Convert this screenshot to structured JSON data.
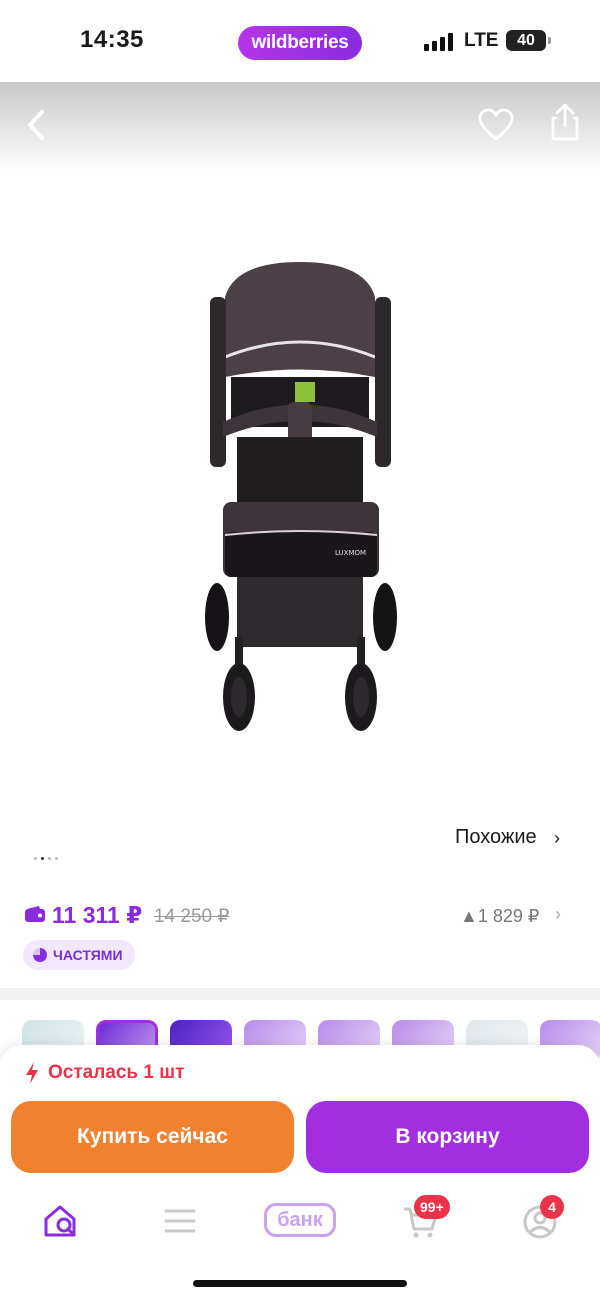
{
  "status_bar": {
    "time": "14:35",
    "brand": "wildberries",
    "network": "LTE",
    "battery": "40"
  },
  "product_header": {
    "back_icon": "chevron-left-icon",
    "favorite_icon": "heart-icon",
    "share_icon": "share-icon"
  },
  "gallery": {
    "product_name_on_image": "LUXMOM",
    "dots_total": 4,
    "active_dot": 2
  },
  "similar": {
    "label": "Похожие",
    "chevron": "›"
  },
  "price": {
    "current": "11 311 ₽",
    "old": "14 250 ₽",
    "delta": "▲1 829 ₽",
    "delta_chevron": "›",
    "installments": "ЧАСТЯМИ",
    "accent_color": "#8a2be2"
  },
  "action_sheet": {
    "stock_text": "Осталась 1 шт",
    "buy_now": "Купить сейчас",
    "add_to_cart": "В корзину",
    "buy_color": "#f0822f",
    "cart_color": "#a32ee0"
  },
  "bottom_nav": {
    "items": [
      {
        "name": "home",
        "icon": "home-search-icon"
      },
      {
        "name": "catalog",
        "icon": "menu-icon"
      },
      {
        "name": "bank",
        "label": "банк"
      },
      {
        "name": "cart",
        "icon": "cart-icon",
        "badge": "99+"
      },
      {
        "name": "profile",
        "icon": "profile-icon",
        "badge": "4"
      }
    ]
  }
}
